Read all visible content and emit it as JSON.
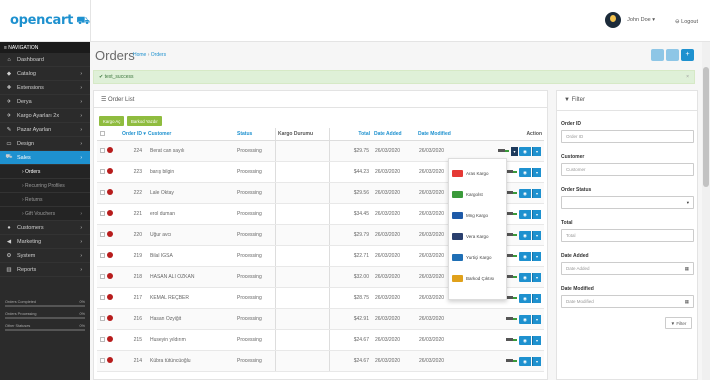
{
  "header": {
    "logo": "opencart",
    "user": "John Doe ▾",
    "logout": "⊖ Logout"
  },
  "nav": {
    "title": "≡ NAVIGATION",
    "items": [
      {
        "icon": "⌂",
        "label": "Dashboard",
        "arrow": ""
      },
      {
        "icon": "◆",
        "label": "Catalog",
        "arrow": "›"
      },
      {
        "icon": "✚",
        "label": "Extensions",
        "arrow": "›"
      },
      {
        "icon": "✈",
        "label": "Derya",
        "arrow": "›"
      },
      {
        "icon": "✈",
        "label": "Kargo Ayarları 2x",
        "arrow": "›"
      },
      {
        "icon": "✎",
        "label": "Pazar Ayarları",
        "arrow": "›"
      },
      {
        "icon": "▭",
        "label": "Design",
        "arrow": "›"
      },
      {
        "icon": "⛟",
        "label": "Sales",
        "arrow": "›"
      },
      {
        "icon": "",
        "label": "› Orders",
        "arrow": ""
      },
      {
        "icon": "",
        "label": "› Recurring Profiles",
        "arrow": ""
      },
      {
        "icon": "",
        "label": "› Returns",
        "arrow": ""
      },
      {
        "icon": "",
        "label": "› Gift Vouchers",
        "arrow": "›"
      },
      {
        "icon": "●",
        "label": "Customers",
        "arrow": "›"
      },
      {
        "icon": "◀",
        "label": "Marketing",
        "arrow": "›"
      },
      {
        "icon": "⚙",
        "label": "System",
        "arrow": "›"
      },
      {
        "icon": "▥",
        "label": "Reports",
        "arrow": "›"
      }
    ],
    "stats": [
      {
        "label": "Orders Completed",
        "value": "0%"
      },
      {
        "label": "Orders Processing",
        "value": "0%"
      },
      {
        "label": "Other Statuses",
        "value": "0%"
      }
    ]
  },
  "page": {
    "title": "Orders",
    "crumb_home": "Home",
    "crumb_sep": "›",
    "crumb_current": "Orders"
  },
  "alert": {
    "text": "✔ text_success",
    "close": "×"
  },
  "list": {
    "title": "☰ Order List",
    "btn_kargo": "Kargo Aç",
    "btn_barkod": "Barkod Yazdır",
    "columns": {
      "id": "Order ID ▾",
      "customer": "Customer",
      "status": "Status",
      "kargo": "Kargo Durumu",
      "total": "Total",
      "added": "Date Added",
      "modified": "Date Modified",
      "action": "Action"
    },
    "rows": [
      {
        "id": "224",
        "customer": "Berat can sayılı",
        "status": "Processing",
        "total": "$29.75",
        "added": "26/03/2020",
        "modified": "26/03/2020"
      },
      {
        "id": "223",
        "customer": "barış bilgin",
        "status": "Processing",
        "total": "$44.23",
        "added": "26/03/2020",
        "modified": "26/03/2020"
      },
      {
        "id": "222",
        "customer": "Lale Oktay",
        "status": "Processing",
        "total": "$29.56",
        "added": "26/03/2020",
        "modified": "26/03/2020"
      },
      {
        "id": "221",
        "customer": "erol duman",
        "status": "Processing",
        "total": "$34.45",
        "added": "26/03/2020",
        "modified": "26/03/2020"
      },
      {
        "id": "220",
        "customer": "Uğur avcı",
        "status": "Processing",
        "total": "$29.79",
        "added": "26/03/2020",
        "modified": "26/03/2020"
      },
      {
        "id": "219",
        "customer": "Bilal IGSA",
        "status": "Processing",
        "total": "$22.71",
        "added": "26/03/2020",
        "modified": "26/03/2020"
      },
      {
        "id": "218",
        "customer": "HASAN ALİ ÖZKAN",
        "status": "Processing",
        "total": "$32.00",
        "added": "26/03/2020",
        "modified": "26/03/2020"
      },
      {
        "id": "217",
        "customer": "KEMAL REÇBER",
        "status": "Processing",
        "total": "$28.75",
        "added": "26/03/2020",
        "modified": "26/03/2020"
      },
      {
        "id": "216",
        "customer": "Hasan Özyiğit",
        "status": "Processing",
        "total": "$42.91",
        "added": "26/03/2020",
        "modified": "26/03/2020"
      },
      {
        "id": "215",
        "customer": "Huseyin yıldırım",
        "status": "Processing",
        "total": "$24.67",
        "added": "26/03/2020",
        "modified": "26/03/2020"
      },
      {
        "id": "214",
        "customer": "Kübra tütüncüoğlu",
        "status": "Processing",
        "total": "$24.67",
        "added": "26/03/2020",
        "modified": "26/03/2020"
      }
    ]
  },
  "dropdown": [
    {
      "label": "Aras Kargo",
      "color": "#e53935"
    },
    {
      "label": "Kargoİst",
      "color": "#3a9a3a"
    },
    {
      "label": "Mng Kargo",
      "color": "#1e5aa8"
    },
    {
      "label": "Vera Kargo",
      "color": "#2a3f6e"
    },
    {
      "label": "Yurtiçi Kargo",
      "color": "#1f6fb5"
    },
    {
      "label": "Barkod Çıktısı",
      "color": "#e0a11b"
    }
  ],
  "filter": {
    "title": "▼ Filter",
    "order_id_label": "Order ID",
    "order_id_ph": "Order ID",
    "customer_label": "Customer",
    "customer_ph": "Customer",
    "status_label": "Order Status",
    "total_label": "Total",
    "total_ph": "Total",
    "added_label": "Date Added",
    "added_ph": "Date Added",
    "modified_label": "Date Modified",
    "modified_ph": "Date Modified",
    "button": "▼ Filter"
  },
  "colors": {
    "brand": "#1e91cf",
    "sidebar": "#2b2b2b",
    "success": "#8fbc3f"
  }
}
